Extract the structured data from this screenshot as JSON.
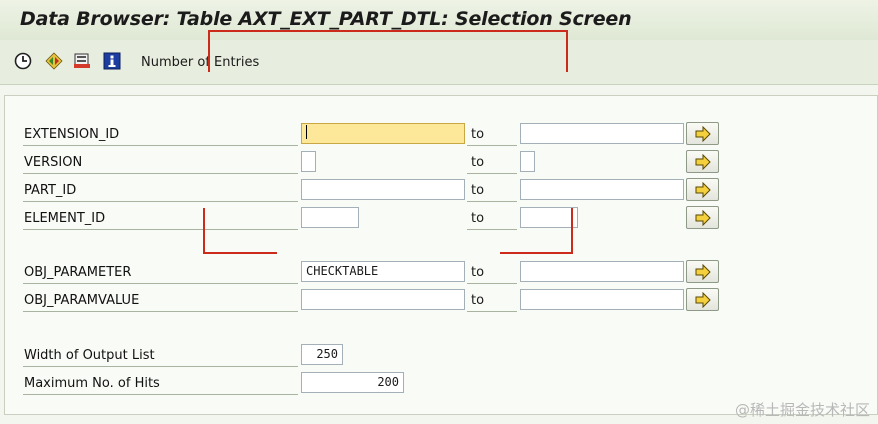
{
  "window": {
    "title": "Data Browser: Table AXT_EXT_PART_DTL: Selection Screen"
  },
  "toolbar": {
    "icons": [
      "execute-icon",
      "selection-options-icon",
      "delete-icon",
      "info-icon"
    ],
    "number_of_entries_label": "Number of Entries"
  },
  "selection": {
    "to_label": "to",
    "rows": [
      {
        "label": "EXTENSION_ID",
        "low": "",
        "high": ""
      },
      {
        "label": "VERSION",
        "low": "",
        "high": ""
      },
      {
        "label": "PART_ID",
        "low": "",
        "high": ""
      },
      {
        "label": "ELEMENT_ID",
        "low": "",
        "high": ""
      },
      {
        "label": "OBJ_PARAMETER",
        "low": "CHECKTABLE",
        "high": ""
      },
      {
        "label": "OBJ_PARAMVALUE",
        "low": "",
        "high": ""
      }
    ]
  },
  "output": {
    "width_label": "Width of Output List",
    "width_value": "250",
    "max_hits_label": "Maximum No. of Hits",
    "max_hits_value": "200"
  },
  "watermark": "@稀土掘金技术社区",
  "colors": {
    "focus_field": "#fde89a",
    "annotation": "#cc2a1a",
    "title_bar": "#dfe8d4"
  }
}
